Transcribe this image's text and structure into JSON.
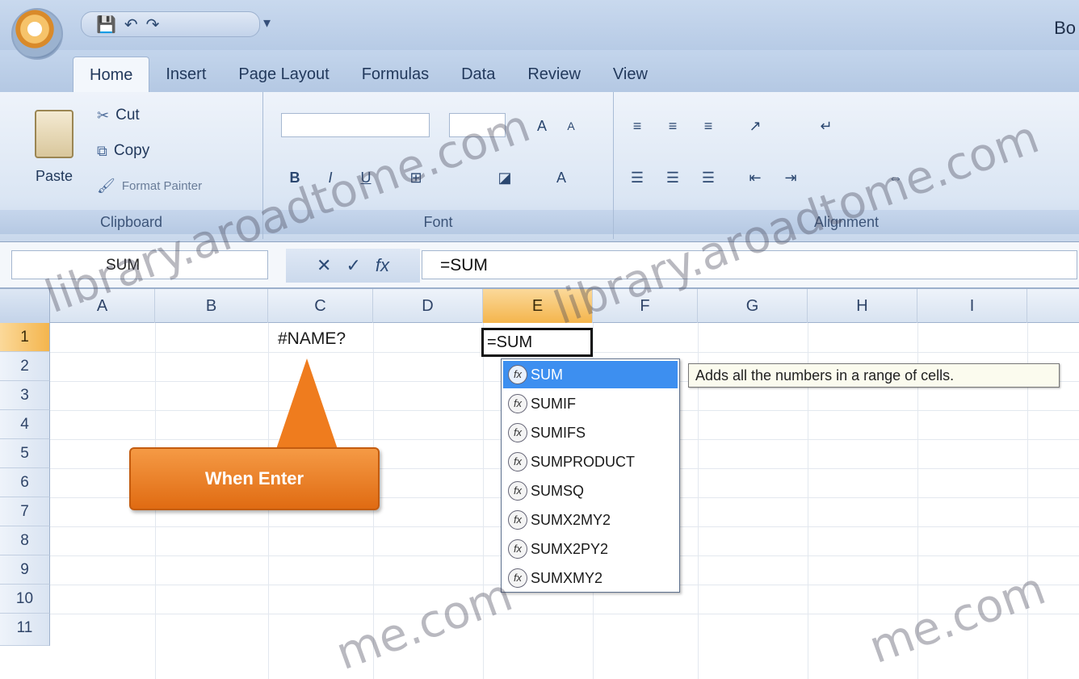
{
  "title_bar": {
    "quick_access": [
      "💾",
      "↶",
      "↷"
    ],
    "window_title": "Bo"
  },
  "ribbon": {
    "tabs": [
      "Home",
      "Insert",
      "Page Layout",
      "Formulas",
      "Data",
      "Review",
      "View"
    ],
    "active_tab": "Home",
    "clipboard": {
      "paste_label": "Paste",
      "cut_label": "Cut",
      "copy_label": "Copy",
      "format_painter_label": "Format Painter",
      "group_label": "Clipboard"
    },
    "font": {
      "group_label": "Font",
      "bold": "B",
      "italic": "I",
      "underline": "U"
    },
    "alignment": {
      "group_label": "Alignment"
    }
  },
  "formula_bar": {
    "name_box": "SUM",
    "cancel": "✕",
    "enter": "✓",
    "fx": "fx",
    "formula": "=SUM"
  },
  "sheet": {
    "columns": [
      "A",
      "B",
      "C",
      "D",
      "E",
      "F",
      "G",
      "H",
      "I"
    ],
    "selected_column": "E",
    "rows": [
      "1",
      "2",
      "3",
      "4",
      "5",
      "6",
      "7",
      "8",
      "9",
      "10",
      "11"
    ],
    "selected_row": "1",
    "cell_c1": "#NAME?",
    "active_cell_value": "=SUM"
  },
  "autocomplete": {
    "items": [
      "SUM",
      "SUMIF",
      "SUMIFS",
      "SUMPRODUCT",
      "SUMSQ",
      "SUMX2MY2",
      "SUMX2PY2",
      "SUMXMY2"
    ],
    "selected": "SUM",
    "tooltip": "Adds all the numbers in a range of cells."
  },
  "callout": {
    "text": "When Enter"
  },
  "watermarks": [
    "library.aroadtome.com",
    "library.aroadtome.com",
    "me.com",
    "me.com"
  ],
  "colors": {
    "callout": "#ef7c1e",
    "selection_highlight": "#3d8ff0",
    "header_selected": "#f4b54d"
  }
}
